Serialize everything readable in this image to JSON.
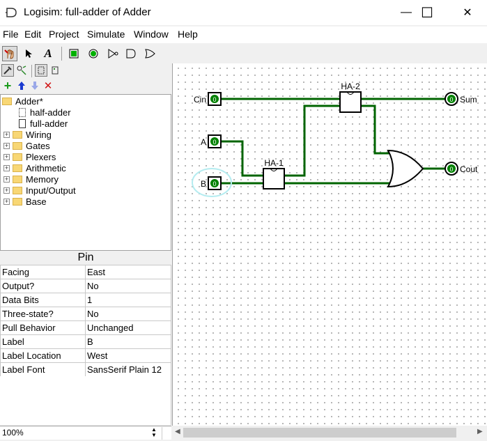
{
  "window": {
    "title": "Logisim: full-adder of Adder",
    "minimize": "—",
    "maximize": "☐",
    "close": "✕"
  },
  "menu": [
    "File",
    "Edit",
    "Project",
    "Simulate",
    "Window",
    "Help"
  ],
  "explorer": {
    "project": "Adder*",
    "circuits": [
      "half-adder",
      "full-adder"
    ],
    "libraries": [
      "Wiring",
      "Gates",
      "Plexers",
      "Arithmetic",
      "Memory",
      "Input/Output",
      "Base"
    ]
  },
  "attributes": {
    "title": "Pin",
    "rows": [
      {
        "key": "Facing",
        "value": "East"
      },
      {
        "key": "Output?",
        "value": "No"
      },
      {
        "key": "Data Bits",
        "value": "1"
      },
      {
        "key": "Three-state?",
        "value": "No"
      },
      {
        "key": "Pull Behavior",
        "value": "Unchanged"
      },
      {
        "key": "Label",
        "value": "B"
      },
      {
        "key": "Label Location",
        "value": "West"
      },
      {
        "key": "Label Font",
        "value": "SansSerif Plain 12"
      }
    ]
  },
  "zoom": "100%",
  "circuit": {
    "inputs": [
      "Cin",
      "A",
      "B"
    ],
    "outputs": [
      "Sum",
      "Cout"
    ],
    "subcircuits": [
      "HA-1",
      "HA-2"
    ],
    "pin_value": "0"
  },
  "colors": {
    "wire": "#006400",
    "pin_fill": "#008000",
    "selection": "#b4ecf0"
  }
}
